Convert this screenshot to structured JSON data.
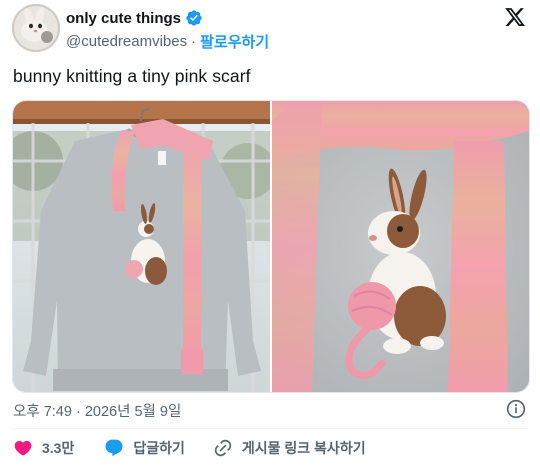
{
  "author": {
    "display_name": "only cute things",
    "handle": "@cutedreamvibes",
    "follow_label": "팔로우하기",
    "separator": "·",
    "verified": true,
    "avatar_icon": "avatar-photo"
  },
  "tweet": {
    "text": "bunny knitting a tiny pink scarf",
    "timestamp": "오후 7:49 · 2026년 5월 9일"
  },
  "actions": {
    "like_count": "3.3만",
    "reply_label": "답글하기",
    "copy_link_label": "게시물 링크 복사하기"
  },
  "colors": {
    "accent": "#1d9bf0",
    "like": "#f91880",
    "muted": "#536471",
    "scarf_pink": "#ee9aa8",
    "sweater_gray": "#b9bec2"
  }
}
